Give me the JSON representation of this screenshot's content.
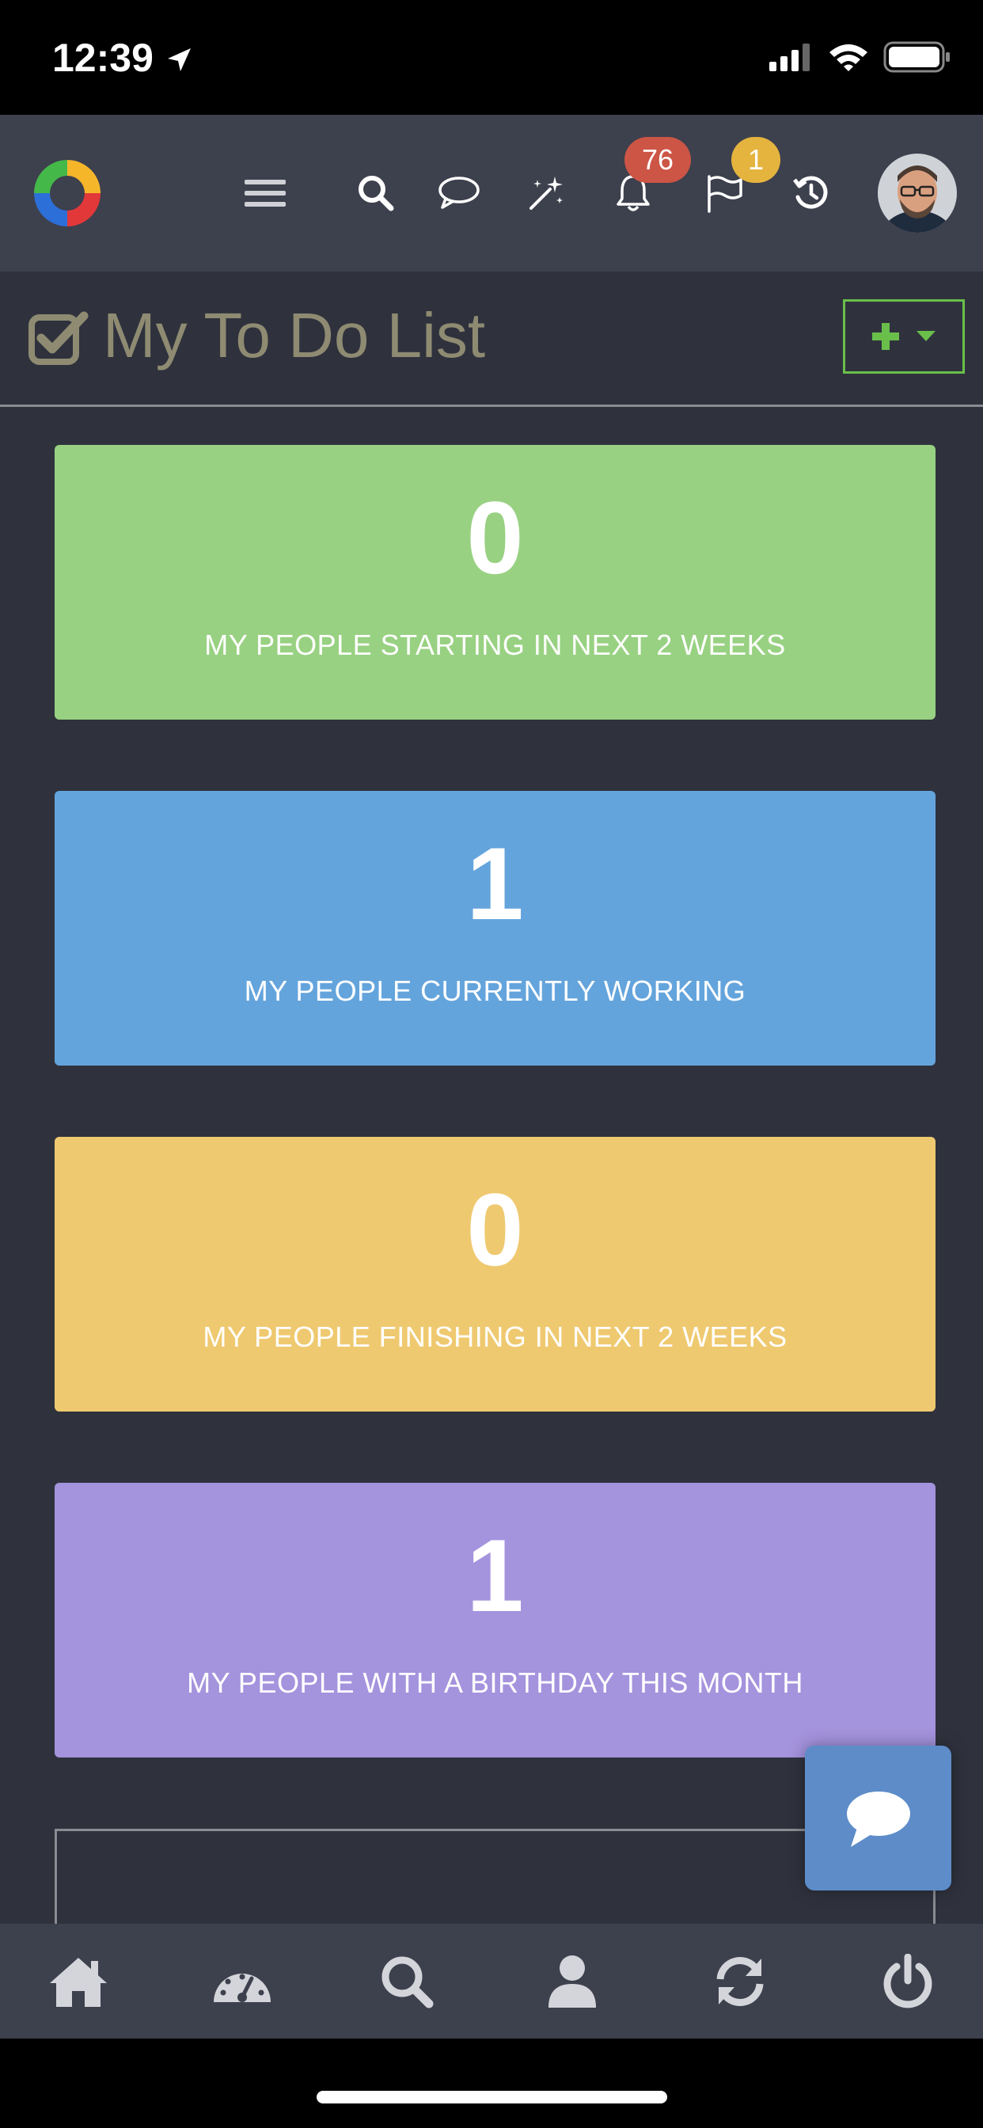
{
  "status_bar": {
    "time": "12:39"
  },
  "navbar": {
    "icons": [
      "app-logo",
      "hamburger-menu-icon",
      "search-icon",
      "chat-bubble-icon",
      "magic-wand-icon",
      "bell-icon",
      "flag-icon",
      "history-icon",
      "user-avatar"
    ],
    "notifications_badge": "76",
    "flags_badge": "1",
    "colors": {
      "notifications": "#cc5545",
      "flags": "#e4b43e"
    }
  },
  "page": {
    "title": "My To Do List",
    "add_button_icon": "plus-icon"
  },
  "cards": [
    {
      "value": "0",
      "label": "MY PEOPLE STARTING IN NEXT 2 WEEKS",
      "color": "#98d182"
    },
    {
      "value": "1",
      "label": "MY PEOPLE CURRENTLY WORKING",
      "color": "#64a4dc"
    },
    {
      "value": "0",
      "label": "MY PEOPLE FINISHING IN NEXT 2 WEEKS",
      "color": "#efc970"
    },
    {
      "value": "1",
      "label": "MY PEOPLE WITH A BIRTHDAY THIS MONTH",
      "color": "#a493dd"
    }
  ],
  "tabbar": {
    "icons": [
      "home-icon",
      "dashboard-icon",
      "search-icon",
      "user-icon",
      "refresh-icon",
      "power-icon"
    ]
  }
}
